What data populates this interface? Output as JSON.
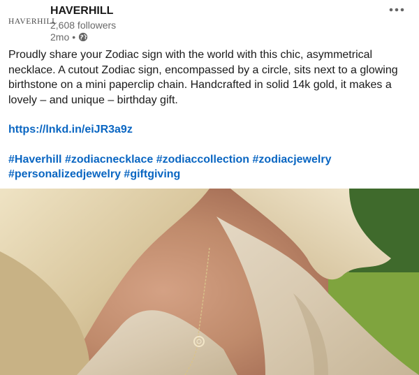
{
  "post": {
    "company_logo_text": "HAVERHILL",
    "company_name": "HAVERHILL",
    "followers": "2,608 followers",
    "time": "2mo",
    "separator": "•",
    "visibility_icon": "globe-icon",
    "more_icon": "more-horizontal-icon",
    "body": "Proudly share your Zodiac sign with the world with this chic, asymmetrical necklace. A cutout Zodiac sign, encompassed by a circle, sits next to a glowing birthstone on a mini paperclip chain. Handcrafted in solid 14k gold, it makes a lovely – and unique – birthday gift.",
    "link": "https://lnkd.in/eiJR3a9z",
    "hashtags": [
      "#Haverhill",
      "#zodiacnecklace",
      "#zodiaccollection",
      "#zodiacjewelry",
      "#personalizedjewelry",
      "#giftgiving"
    ]
  },
  "colors": {
    "link": "#0a66c2",
    "secondary_text": "#666666"
  }
}
